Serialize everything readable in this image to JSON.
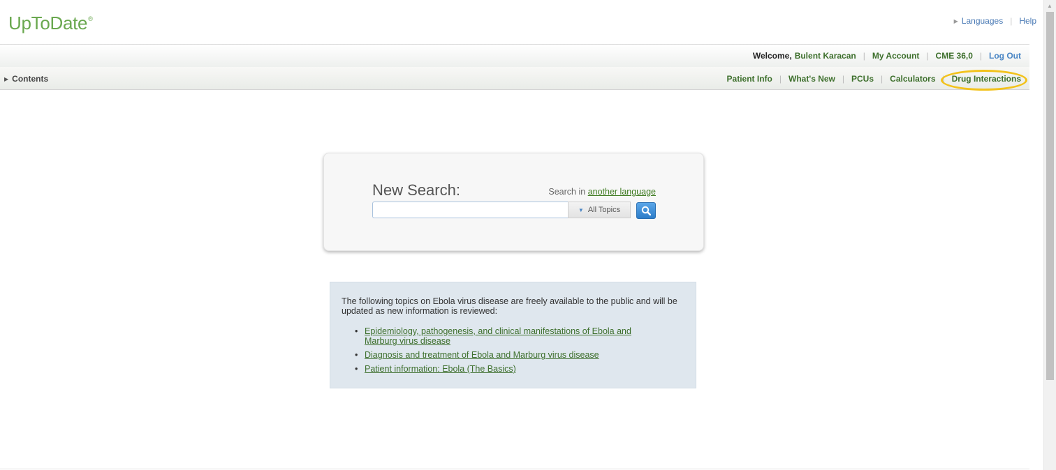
{
  "app": {
    "logo_text": "UpToDate",
    "logo_mark": "®"
  },
  "top_links": {
    "languages": "Languages",
    "help": "Help"
  },
  "user_bar": {
    "welcome_label": "Welcome,",
    "user_name": "Bulent Karacan",
    "my_account": "My Account",
    "cme": "CME 36,0",
    "logout": "Log Out"
  },
  "nav": {
    "contents": "Contents",
    "items": [
      "Patient Info",
      "What's New",
      "PCUs",
      "Calculators",
      "Drug Interactions"
    ],
    "highlighted_item": "Drug Interactions",
    "highlight_color": "#f2c21b"
  },
  "search": {
    "title": "New Search:",
    "lang_prefix": "Search in",
    "lang_link": "another language",
    "input_value": "",
    "scope": "All Topics",
    "button_icon": "search-icon"
  },
  "info": {
    "intro": "The following topics on Ebola virus disease are freely available to the public and will be updated as new information is reviewed:",
    "topics": [
      "Epidemiology, pathogenesis, and clinical manifestations of Ebola and Marburg virus disease",
      "Diagnosis and treatment of Ebola and Marburg virus disease",
      "Patient information: Ebola (The Basics)"
    ]
  },
  "colors": {
    "brand_green": "#6aa84f",
    "link_green": "#3d6f2c",
    "link_blue": "#4a86c5",
    "info_bg": "#dfe7ee"
  }
}
